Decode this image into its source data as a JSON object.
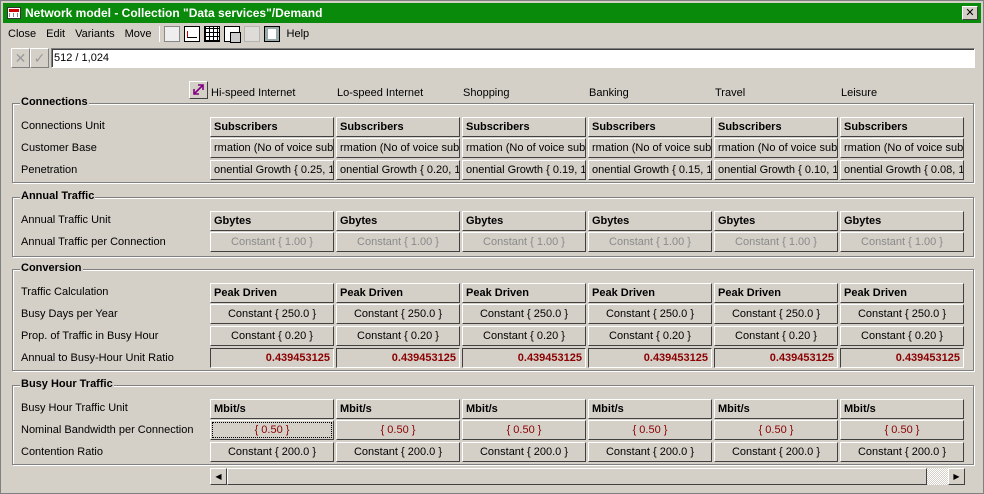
{
  "window": {
    "title": "Network model - Collection \"Data services\"/Demand",
    "close_glyph": "✕"
  },
  "menu": {
    "close": "Close",
    "edit": "Edit",
    "variants": "Variants",
    "move": "Move",
    "help": "Help"
  },
  "formula": {
    "cancel_glyph": "✕",
    "accept_glyph": "✓",
    "value": "512 / 1,024"
  },
  "columns": [
    "Hi-speed Internet",
    "Lo-speed Internet",
    "Shopping",
    "Banking",
    "Travel",
    "Leisure"
  ],
  "groups": {
    "connections": {
      "title": "Connections",
      "rows": [
        {
          "label": "Connections Unit",
          "values": [
            "Subscribers",
            "Subscribers",
            "Subscribers",
            "Subscribers",
            "Subscribers",
            "Subscribers"
          ]
        },
        {
          "label": "Customer Base",
          "values": [
            "rmation (No of voice subs",
            "rmation (No of voice subs",
            "rmation (No of voice subs",
            "rmation (No of voice subs",
            "rmation (No of voice subs",
            "rmation (No of voice subs"
          ]
        },
        {
          "label": "Penetration",
          "values": [
            "onential Growth { 0.25, 1.",
            "onential Growth { 0.20, 1.",
            "onential Growth { 0.19, 1.",
            "onential Growth { 0.15, 1.",
            "onential Growth { 0.10, 1.",
            "onential Growth { 0.08, 1."
          ]
        }
      ]
    },
    "annual_traffic": {
      "title": "Annual Traffic",
      "rows": [
        {
          "label": "Annual Traffic Unit",
          "values": [
            "Gbytes",
            "Gbytes",
            "Gbytes",
            "Gbytes",
            "Gbytes",
            "Gbytes"
          ]
        },
        {
          "label": "Annual Traffic per Connection",
          "values": [
            "Constant { 1.00 }",
            "Constant { 1.00 }",
            "Constant { 1.00 }",
            "Constant { 1.00 }",
            "Constant { 1.00 }",
            "Constant { 1.00 }"
          ]
        }
      ]
    },
    "conversion": {
      "title": "Conversion",
      "rows": [
        {
          "label": "Traffic Calculation",
          "values": [
            "Peak Driven",
            "Peak Driven",
            "Peak Driven",
            "Peak Driven",
            "Peak Driven",
            "Peak Driven"
          ]
        },
        {
          "label": "Busy Days per Year",
          "values": [
            "Constant { 250.0 }",
            "Constant { 250.0 }",
            "Constant { 250.0 }",
            "Constant { 250.0 }",
            "Constant { 250.0 }",
            "Constant { 250.0 }"
          ]
        },
        {
          "label": "Prop. of Traffic in Busy Hour",
          "values": [
            "Constant { 0.20 }",
            "Constant { 0.20 }",
            "Constant { 0.20 }",
            "Constant { 0.20 }",
            "Constant { 0.20 }",
            "Constant { 0.20 }"
          ]
        },
        {
          "label": "Annual to Busy-Hour Unit Ratio",
          "values": [
            "0.439453125",
            "0.439453125",
            "0.439453125",
            "0.439453125",
            "0.439453125",
            "0.439453125"
          ]
        }
      ]
    },
    "busy_hour": {
      "title": "Busy Hour Traffic",
      "rows": [
        {
          "label": "Busy Hour Traffic Unit",
          "values": [
            "Mbit/s",
            "Mbit/s",
            "Mbit/s",
            "Mbit/s",
            "Mbit/s",
            "Mbit/s"
          ]
        },
        {
          "label": "Nominal Bandwidth per Connection",
          "values": [
            "{ 0.50 }",
            "{ 0.50 }",
            "{ 0.50 }",
            "{ 0.50 }",
            "{ 0.50 }",
            "{ 0.50 }"
          ]
        },
        {
          "label": "Contention Ratio",
          "values": [
            "Constant { 200.0 }",
            "Constant { 200.0 }",
            "Constant { 200.0 }",
            "Constant { 200.0 }",
            "Constant { 200.0 }",
            "Constant { 200.0 }"
          ]
        }
      ]
    }
  },
  "scrollbar": {
    "left_arrow": "◀",
    "right_arrow": "▶"
  }
}
